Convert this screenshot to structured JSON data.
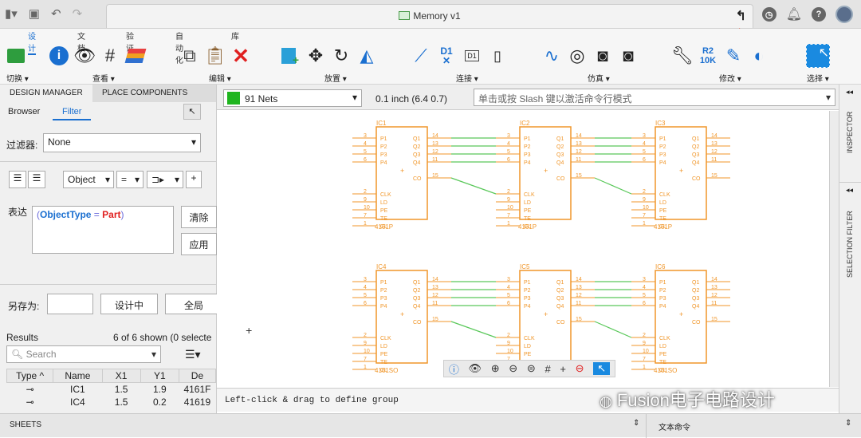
{
  "window": {
    "title": "Memory v1"
  },
  "ribbon": {
    "tabs": [
      "设计",
      "文档",
      "验证",
      "自动化",
      "库"
    ],
    "active_tab": "设计",
    "groups": [
      "切换",
      "查看",
      "编辑",
      "放置",
      "连接",
      "仿真",
      "修改",
      "选择"
    ],
    "tool_text": {
      "d1": "D1",
      "d1_box": "D1",
      "r2": "R2",
      "r2_value": "10K"
    }
  },
  "left_panel": {
    "tabs": [
      "DESIGN MANAGER",
      "PLACE COMPONENTS"
    ],
    "subtabs": [
      "Browser",
      "Filter"
    ],
    "active_subtab": "Filter",
    "filter_label": "过滤器:",
    "filter_value": "None",
    "object_select": "Object",
    "op_select": "=",
    "expression_label": "表达",
    "expression": {
      "open": "(",
      "key": "ObjectType",
      "op": " = ",
      "val": "Part",
      "close": ")"
    },
    "clear_button": "清除",
    "apply_button": "应用",
    "save_as_label": "另存为:",
    "save_in_design_button": "设计中",
    "global_button": "全局",
    "results_label": "Results",
    "results_count": "6 of 6 shown (0 selecte",
    "search_placeholder": "Search",
    "columns": [
      "Type",
      "Name",
      "X1",
      "Y1",
      "De"
    ],
    "rows": [
      {
        "name": "IC1",
        "x1": "1.5",
        "y1": "1.9",
        "de": "4161F"
      },
      {
        "name": "IC4",
        "x1": "1.5",
        "y1": "0.2",
        "de": "41619"
      }
    ]
  },
  "canvas": {
    "nets": "91 Nets",
    "net_color": "#1fb51f",
    "grid": "0.1 inch (6.4 0.7)",
    "command_placeholder": "单击或按 Slash 键以激活命令行模式",
    "status": "Left-click & drag to define group",
    "chips": [
      {
        "name": "IC1",
        "part": "4161P"
      },
      {
        "name": "IC2",
        "part": "4161P"
      },
      {
        "name": "IC3",
        "part": "4161P"
      },
      {
        "name": "IC4",
        "part": "4161SO"
      },
      {
        "name": "IC5",
        "part": "4161SO"
      },
      {
        "name": "IC6",
        "part": "4161SO"
      }
    ],
    "pins_left": [
      "P1",
      "P2",
      "P3",
      "P4",
      "CLK",
      "LD",
      "PE",
      "TE",
      "CL"
    ],
    "pins_left_num": [
      "3",
      "4",
      "5",
      "6",
      "2",
      "9",
      "10",
      "7",
      "1"
    ],
    "pins_right": [
      "Q1",
      "Q2",
      "Q3",
      "Q4",
      "CO"
    ],
    "pins_right_num": [
      "14",
      "13",
      "12",
      "11",
      "15"
    ],
    "chip_color": "#f0962a",
    "wire_color": "#5ac85a"
  },
  "side_tabs": {
    "inspector": "INSPECTOR",
    "selection_filter": "SELECTION FILTER"
  },
  "bottom": {
    "sheets": "SHEETS",
    "text_command": "文本命令"
  },
  "watermark": "Fusion电子电路设计"
}
